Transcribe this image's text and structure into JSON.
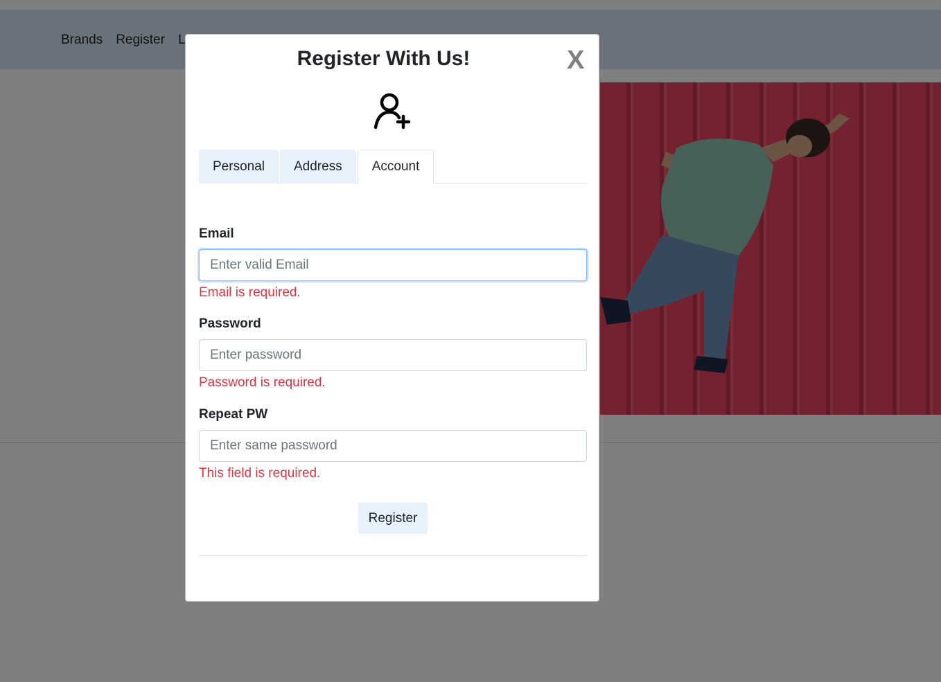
{
  "nav": {
    "links": [
      "Brands",
      "Register",
      "Log"
    ]
  },
  "modal": {
    "title": "Register With Us!",
    "close_label": "X",
    "icon": "user-add-icon",
    "tabs": [
      {
        "label": "Personal",
        "active": false
      },
      {
        "label": "Address",
        "active": false
      },
      {
        "label": "Account",
        "active": true
      }
    ],
    "fields": {
      "email": {
        "label": "Email",
        "placeholder": "Enter valid Email",
        "value": "",
        "error": "Email is required."
      },
      "password": {
        "label": "Password",
        "placeholder": "Enter password",
        "value": "",
        "error": "Password is required."
      },
      "repeat": {
        "label": "Repeat PW",
        "placeholder": "Enter same password",
        "value": "",
        "error": "This field is required."
      }
    },
    "submit_label": "Register"
  },
  "colors": {
    "navbar": "#d3e4f6",
    "error": "#dc3545",
    "button_bg": "#e6f1fb",
    "focus_border": "#86b7fe",
    "hero_photo": "#e8455f"
  }
}
